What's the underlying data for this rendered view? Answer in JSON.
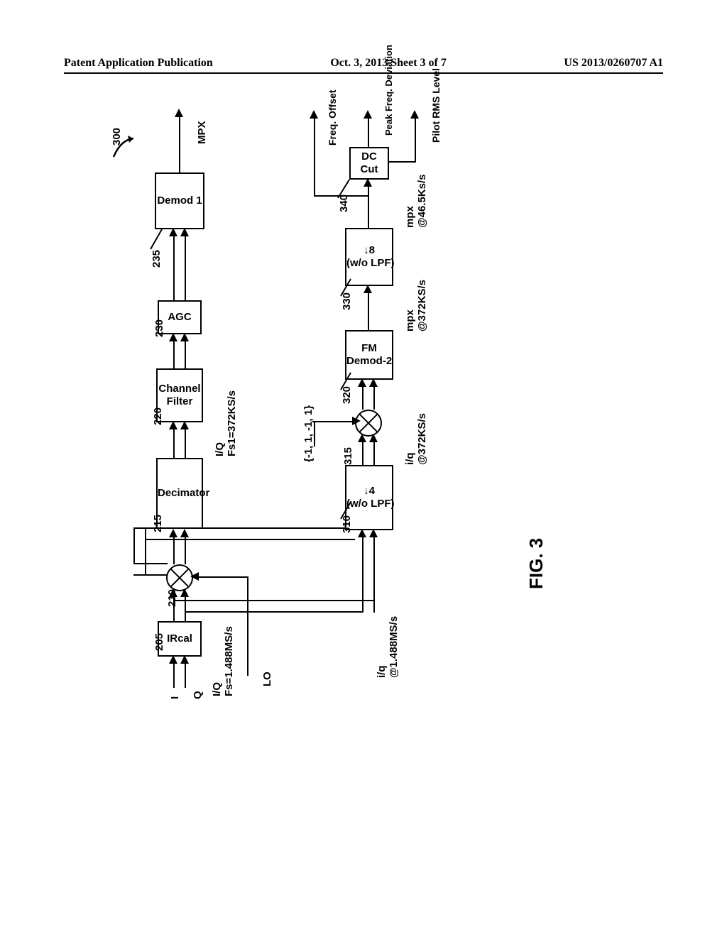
{
  "header": {
    "left": "Patent Application Publication",
    "center": "Oct. 3, 2013   Sheet 3 of 7",
    "right": "US 2013/0260707 A1"
  },
  "diagram": {
    "ref_main": "300",
    "inputs": {
      "i": "I",
      "q": "Q",
      "iq_rate": "I/Q\nFs=1.488MS/s",
      "lo": "LO"
    },
    "blocks": {
      "ircal": "IRcal",
      "decimator": "Decimator",
      "chfilter": "Channel\nFilter",
      "agc": "AGC",
      "demod1": "Demod 1",
      "down4": "↓4\n(w/o LPF)",
      "fmdemod2": "FM\nDemod-2",
      "down8": "↓8\n(w/o LPF)",
      "dccut": "DC\nCut"
    },
    "refs": {
      "ircal": "205",
      "mixer1": "210",
      "decimator": "215",
      "chfilter": "220",
      "agc": "230",
      "demod1": "235",
      "down4": "310",
      "mixer2": "315",
      "fmdemod2": "320",
      "down8": "330",
      "dccut": "340"
    },
    "labels": {
      "iq_1488": "i/q\n@1.488MS/s",
      "iq_372_top": "i/q\n@372KS/s",
      "mpx_372": "mpx\n@372KS/s",
      "mpx_465": "mpx\n@46.5Ks/s",
      "mix_seq": "{-1, 1, -1, 1}",
      "iq_fs1": "I/Q\nFs1=372KS/s",
      "out_mpx": "MPX",
      "out_pilot": "Pilot RMS Level",
      "out_peak": "Peak Freq. Deviation",
      "out_freq": "Freq. Offset"
    }
  },
  "figure": "FIG. 3"
}
